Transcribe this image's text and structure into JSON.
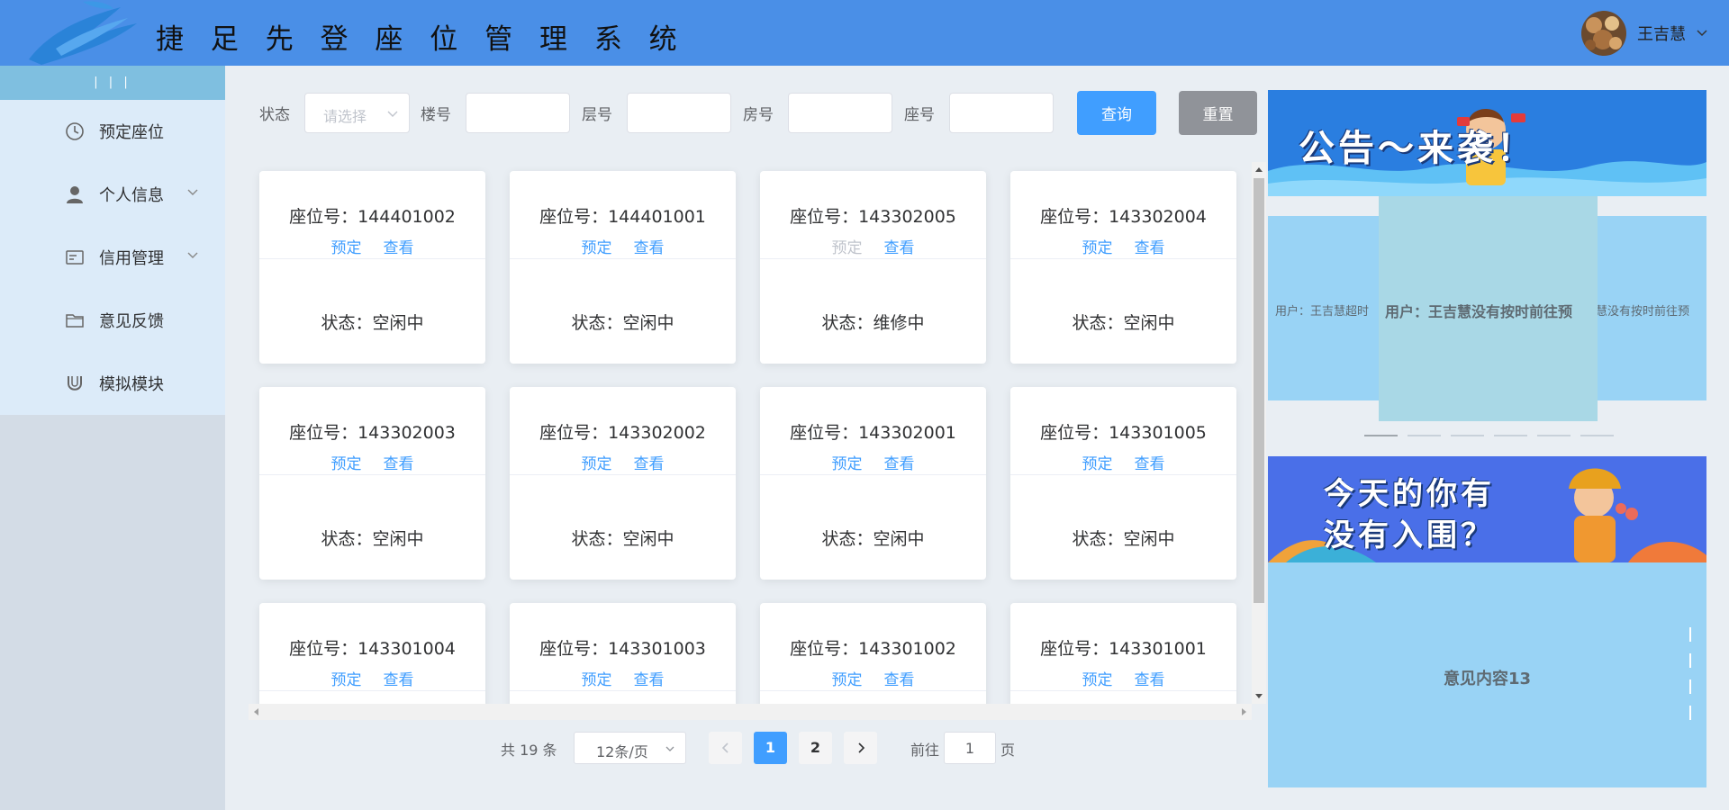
{
  "header": {
    "title": "捷 足 先 登 座 位 管 理 系 统",
    "username": "王吉慧",
    "caret_icon": "chevron-down-icon"
  },
  "sidebar": {
    "collapse_label": "| | |",
    "items": [
      {
        "label": "预定座位",
        "icon": "clock-icon",
        "has_submenu": false
      },
      {
        "label": "个人信息",
        "icon": "user-icon",
        "has_submenu": true
      },
      {
        "label": "信用管理",
        "icon": "id-card-icon",
        "has_submenu": true
      },
      {
        "label": "意见反馈",
        "icon": "folder-icon",
        "has_submenu": false
      },
      {
        "label": "模拟模块",
        "icon": "magnet-icon",
        "has_submenu": false
      }
    ]
  },
  "filters": {
    "status_label": "状态",
    "status_placeholder": "请选择",
    "building_label": "楼号",
    "floor_label": "层号",
    "room_label": "房号",
    "seat_label": "座号",
    "query_button": "查询",
    "reset_button": "重置"
  },
  "seats": [
    {
      "title": "座位号：144401002",
      "reserve": "预定",
      "view": "查看",
      "status": "状态：空闲中",
      "reserve_enabled": true
    },
    {
      "title": "座位号：144401001",
      "reserve": "预定",
      "view": "查看",
      "status": "状态：空闲中",
      "reserve_enabled": true
    },
    {
      "title": "座位号：143302005",
      "reserve": "预定",
      "view": "查看",
      "status": "状态：维修中",
      "reserve_enabled": false
    },
    {
      "title": "座位号：143302004",
      "reserve": "预定",
      "view": "查看",
      "status": "状态：空闲中",
      "reserve_enabled": true
    },
    {
      "title": "座位号：143302003",
      "reserve": "预定",
      "view": "查看",
      "status": "状态：空闲中",
      "reserve_enabled": true
    },
    {
      "title": "座位号：143302002",
      "reserve": "预定",
      "view": "查看",
      "status": "状态：空闲中",
      "reserve_enabled": true
    },
    {
      "title": "座位号：143302001",
      "reserve": "预定",
      "view": "查看",
      "status": "状态：空闲中",
      "reserve_enabled": true
    },
    {
      "title": "座位号：143301005",
      "reserve": "预定",
      "view": "查看",
      "status": "状态：空闲中",
      "reserve_enabled": true
    },
    {
      "title": "座位号：143301004",
      "reserve": "预定",
      "view": "查看",
      "status": "",
      "reserve_enabled": true
    },
    {
      "title": "座位号：143301003",
      "reserve": "预定",
      "view": "查看",
      "status": "",
      "reserve_enabled": true
    },
    {
      "title": "座位号：143301002",
      "reserve": "预定",
      "view": "查看",
      "status": "",
      "reserve_enabled": true
    },
    {
      "title": "座位号：143301001",
      "reserve": "预定",
      "view": "查看",
      "status": "",
      "reserve_enabled": true
    }
  ],
  "pagination": {
    "total": "共 19 条",
    "page_size": "12条/页",
    "prev_icon": "chevron-left-icon",
    "next_icon": "chevron-right-icon",
    "pages": [
      "1",
      "2"
    ],
    "current": "1",
    "goto_label": "前往",
    "goto_value": "1",
    "goto_unit": "页"
  },
  "right_panel": {
    "banner1_text": "公告～来袭！",
    "carousel": {
      "left": "用户：王吉慧超时",
      "main": "用户：王吉慧没有按时前往预",
      "right": "慧没有按时前往预"
    },
    "banner2_line1": "今天的你有",
    "banner2_line2": "没有入围？",
    "feedback_text": "意见内容13"
  },
  "colors": {
    "header_bg": "#4a8fe7",
    "primary": "#409eff",
    "reset_btn": "#909399",
    "sidebar_menu_bg": "#dcebf9",
    "collapse_bar": "#7fbfe0",
    "panel_bg": "#99d3f5"
  }
}
